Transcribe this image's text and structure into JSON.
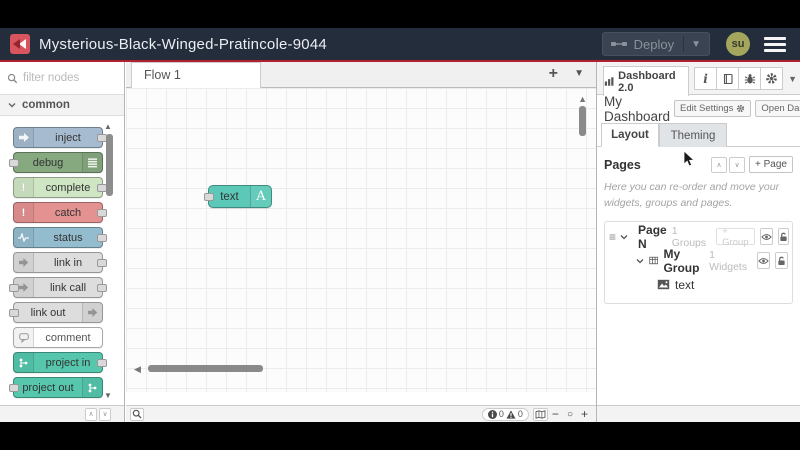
{
  "header": {
    "title": "Mysterious-Black-Winged-Pratincole-9044",
    "deploy_label": "Deploy",
    "avatar_initials": "su"
  },
  "palette": {
    "search_placeholder": "filter nodes",
    "category": "common",
    "nodes": [
      {
        "label": "inject",
        "color": "#a6bbcf",
        "icon": "inject-icon",
        "icon_side": "left",
        "ports": "right"
      },
      {
        "label": "debug",
        "color": "#87a980",
        "icon": "debug-icon",
        "icon_side": "right",
        "ports": "left"
      },
      {
        "label": "complete",
        "color": "#cfe6c4",
        "icon": "complete-icon",
        "icon_side": "left",
        "ports": "right"
      },
      {
        "label": "catch",
        "color": "#e49191",
        "icon": "catch-icon",
        "icon_side": "left",
        "ports": "right"
      },
      {
        "label": "status",
        "color": "#94bccf",
        "icon": "status-icon",
        "icon_side": "left",
        "ports": "right"
      },
      {
        "label": "link in",
        "color": "#dddddd",
        "icon": "link-icon",
        "icon_side": "left",
        "ports": "right"
      },
      {
        "label": "link call",
        "color": "#dddddd",
        "icon": "link-icon",
        "icon_side": "left",
        "ports": "both"
      },
      {
        "label": "link out",
        "color": "#dddddd",
        "icon": "link-icon",
        "icon_side": "right",
        "ports": "left"
      },
      {
        "label": "comment",
        "color": "#ffffff",
        "icon": "comment-icon",
        "icon_side": "left",
        "ports": "none"
      },
      {
        "label": "project in",
        "color": "#56c7ad",
        "icon": "project-icon",
        "icon_side": "left",
        "ports": "right"
      },
      {
        "label": "project out",
        "color": "#56c7ad",
        "icon": "project-icon",
        "icon_side": "right",
        "ports": "left"
      }
    ]
  },
  "workspace": {
    "tab_label": "Flow 1",
    "add_flow_label": "+",
    "node": {
      "label": "text",
      "icon_letter": "A",
      "color": "#5cc8b7"
    }
  },
  "canvas_footer": {
    "info_count": "0",
    "warning_count": "0",
    "zoom_out": "−",
    "zoom_reset": "○",
    "zoom_in": "+"
  },
  "sidebar": {
    "tab_label": "Dashboard 2.0",
    "title": "My Dashboard",
    "edit_settings_label": "Edit Settings",
    "open_dashboard_label": "Open Dashboard",
    "tab_layout": "Layout",
    "tab_theming": "Theming",
    "pages_title": "Pages",
    "add_page_label": "+ Page",
    "help_text": "Here you can re-order and move your widgets, groups and pages.",
    "tree": {
      "page_name": "Page N",
      "page_count": "1 Groups",
      "add_group_label": "+ Group",
      "group_name": "My Group",
      "group_count": "1 Widgets",
      "widget_name": "text"
    }
  },
  "colors": {
    "header_bg": "#232d3c",
    "header_accent": "#b0202e",
    "ui_node_teal": "#5cc8b7"
  }
}
